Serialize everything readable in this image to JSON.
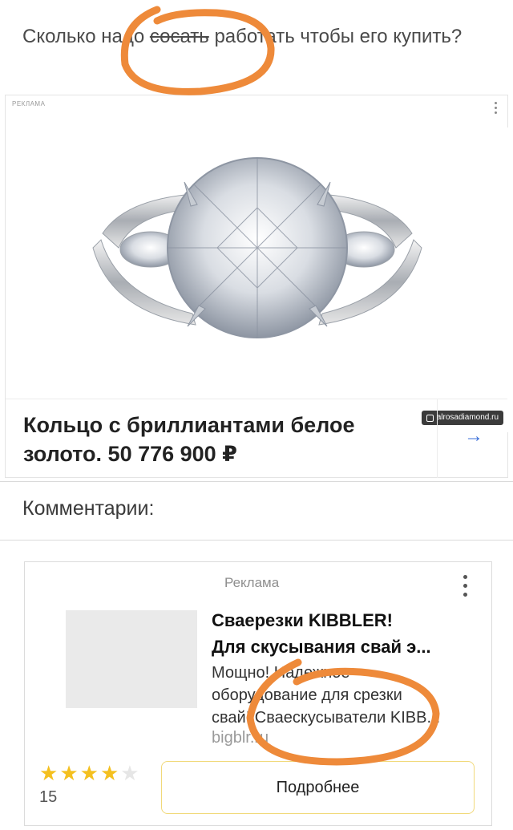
{
  "post": {
    "before": "Сколько надо ",
    "struck": "сосать",
    "after": " работать чтобы его купить?"
  },
  "ad1": {
    "label": "РЕКЛАМА",
    "domain": "alrosadiamond.ru",
    "title": "Кольцо с бриллиантами белое золото. 50 776 900 ₽",
    "arrow": "→"
  },
  "comments": {
    "heading": "Комментарии:"
  },
  "ad2": {
    "label": "Реклама",
    "title_line1": "Сваерезки KIBBLER!",
    "title_line2": "Для скусывания свай э...",
    "desc_line1": "Мощно! Надежное",
    "desc_line2": "оборудование для срезки",
    "desc_line3": "свай! Сваескусыватели KIBB...",
    "domain": "bigblr.ru",
    "rating": 4,
    "rating_max": 5,
    "reviews": "15",
    "button": "Подробнее"
  },
  "colors": {
    "annotation": "#ee8a3a",
    "arrow": "#3b6fd8",
    "star": "#f4c01f"
  }
}
